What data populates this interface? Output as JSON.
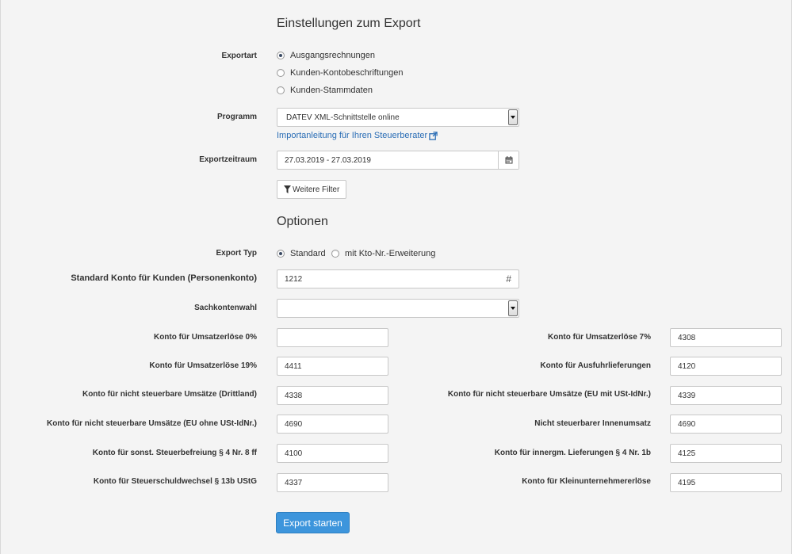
{
  "section_export": {
    "title": "Einstellungen zum Export",
    "exportart": {
      "label": "Exportart",
      "options": [
        "Ausgangsrechnungen",
        "Kunden-Kontobeschriftungen",
        "Kunden-Stammdaten"
      ],
      "selected": 0
    },
    "programm": {
      "label": "Programm",
      "value": "DATEV XML-Schnittstelle online",
      "link": "Importanleitung für Ihren Steuerberater"
    },
    "zeitraum": {
      "label": "Exportzeitraum",
      "value": "27.03.2019 - 27.03.2019"
    },
    "filter_button": "Weitere Filter"
  },
  "section_optionen": {
    "title": "Optionen",
    "export_typ": {
      "label": "Export Typ",
      "options": [
        "Standard",
        "mit Kto-Nr.-Erweiterung"
      ],
      "selected": 0
    },
    "standard_konto": {
      "label": "Standard Konto für Kunden (Personenkonto)",
      "value": "1212"
    },
    "sachkontenwahl": {
      "label": "Sachkontenwahl",
      "value": ""
    },
    "konten_left": [
      {
        "label": "Konto für Umsatzerlöse 0%",
        "value": ""
      },
      {
        "label": "Konto für Umsatzerlöse 19%",
        "value": "4411"
      },
      {
        "label": "Konto für nicht steuerbare Umsätze (Drittland)",
        "value": "4338"
      },
      {
        "label": "Konto für nicht steuerbare Umsätze (EU ohne USt-IdNr.)",
        "value": "4690"
      },
      {
        "label": "Konto für sonst. Steuerbefreiung § 4 Nr. 8 ff",
        "value": "4100"
      },
      {
        "label": "Konto für Steuerschuldwechsel § 13b UStG",
        "value": "4337"
      }
    ],
    "konten_right": [
      {
        "label": "Konto für Umsatzerlöse 7%",
        "value": "4308"
      },
      {
        "label": "Konto für Ausfuhrlieferungen",
        "value": "4120"
      },
      {
        "label": "Konto für nicht steuerbare Umsätze (EU mit USt-IdNr.)",
        "value": "4339"
      },
      {
        "label": "Nicht steuerbarer Innenumsatz",
        "value": "4690"
      },
      {
        "label": "Konto für innergm. Lieferungen § 4 Nr. 1b",
        "value": "4125"
      },
      {
        "label": "Konto für Kleinunternehmererlöse",
        "value": "4195"
      }
    ]
  },
  "submit_button": "Export starten",
  "colors": {
    "primary": "#3d95dc",
    "link": "#2a6db5",
    "background": "#f4f4f4"
  }
}
